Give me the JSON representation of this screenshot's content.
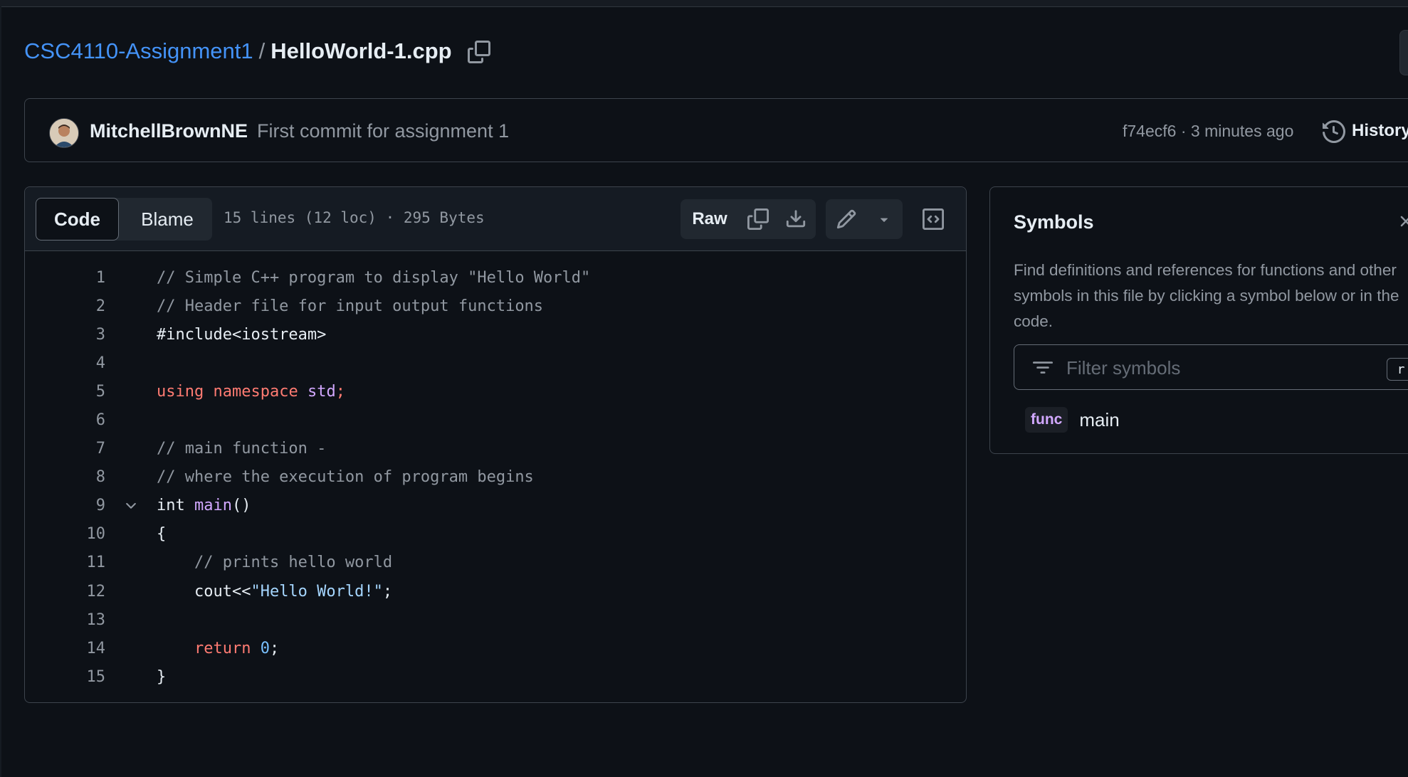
{
  "breadcrumb": {
    "repo": "CSC4110-Assignment1",
    "separator": "/",
    "file": "HelloWorld-1.cpp"
  },
  "commit": {
    "author": "MitchellBrownNE",
    "message": "First commit for assignment 1",
    "sha_time": "f74ecf6 · 3 minutes ago",
    "history_label": "History"
  },
  "toolbar": {
    "tab_code": "Code",
    "tab_blame": "Blame",
    "file_info": "15 lines (12 loc) · 295 Bytes",
    "raw_label": "Raw"
  },
  "code_lines": [
    {
      "n": "1",
      "segments": [
        [
          "comment",
          "// Simple C++ program to display \"Hello World\""
        ]
      ]
    },
    {
      "n": "2",
      "segments": [
        [
          "comment",
          "// Header file for input output functions"
        ]
      ]
    },
    {
      "n": "3",
      "segments": [
        [
          "plain",
          "#include<iostream>"
        ]
      ]
    },
    {
      "n": "4",
      "segments": []
    },
    {
      "n": "5",
      "segments": [
        [
          "kw",
          "using"
        ],
        [
          "plain",
          " "
        ],
        [
          "kw",
          "namespace"
        ],
        [
          "plain",
          " "
        ],
        [
          "ent",
          "std"
        ],
        [
          "kw",
          ";"
        ]
      ]
    },
    {
      "n": "6",
      "segments": []
    },
    {
      "n": "7",
      "segments": [
        [
          "comment",
          "// main function -"
        ]
      ]
    },
    {
      "n": "8",
      "segments": [
        [
          "comment",
          "// where the execution of program begins"
        ]
      ]
    },
    {
      "n": "9",
      "fold": true,
      "segments": [
        [
          "plain",
          "int "
        ],
        [
          "ent",
          "main"
        ],
        [
          "plain",
          "()"
        ]
      ]
    },
    {
      "n": "10",
      "segments": [
        [
          "plain",
          "{"
        ]
      ]
    },
    {
      "n": "11",
      "segments": [
        [
          "plain",
          "    "
        ],
        [
          "comment",
          "// prints hello world"
        ]
      ]
    },
    {
      "n": "12",
      "segments": [
        [
          "plain",
          "    cout<<"
        ],
        [
          "str",
          "\"Hello World!\""
        ],
        [
          "plain",
          ";"
        ]
      ]
    },
    {
      "n": "13",
      "segments": []
    },
    {
      "n": "14",
      "segments": [
        [
          "plain",
          "    "
        ],
        [
          "kw",
          "return"
        ],
        [
          "plain",
          " "
        ],
        [
          "num",
          "0"
        ],
        [
          "plain",
          ";"
        ]
      ]
    },
    {
      "n": "15",
      "segments": [
        [
          "plain",
          "}"
        ]
      ]
    }
  ],
  "symbols": {
    "title": "Symbols",
    "description": "Find definitions and references for functions and other symbols in this file by clicking a symbol below or in the code.",
    "filter_placeholder": "Filter symbols",
    "shortcut": "r",
    "items": [
      {
        "kind": "func",
        "name": "main"
      }
    ]
  },
  "icons": {
    "copy_path": "copy-icon",
    "history": "history-icon",
    "copy_raw": "copy-icon",
    "download": "download-icon",
    "edit": "pencil-icon",
    "more": "triangle-down-icon",
    "symbols_toggle": "code-square-icon",
    "close": "x-icon",
    "filter": "filter-icon",
    "fold": "chevron-down-icon"
  },
  "colors": {
    "background": "#0d1117",
    "link": "#4493f8",
    "keyword": "#ff7b72",
    "entity": "#d2a8ff",
    "string": "#a5d6ff",
    "constant": "#79c0ff",
    "comment": "#9198a1"
  }
}
